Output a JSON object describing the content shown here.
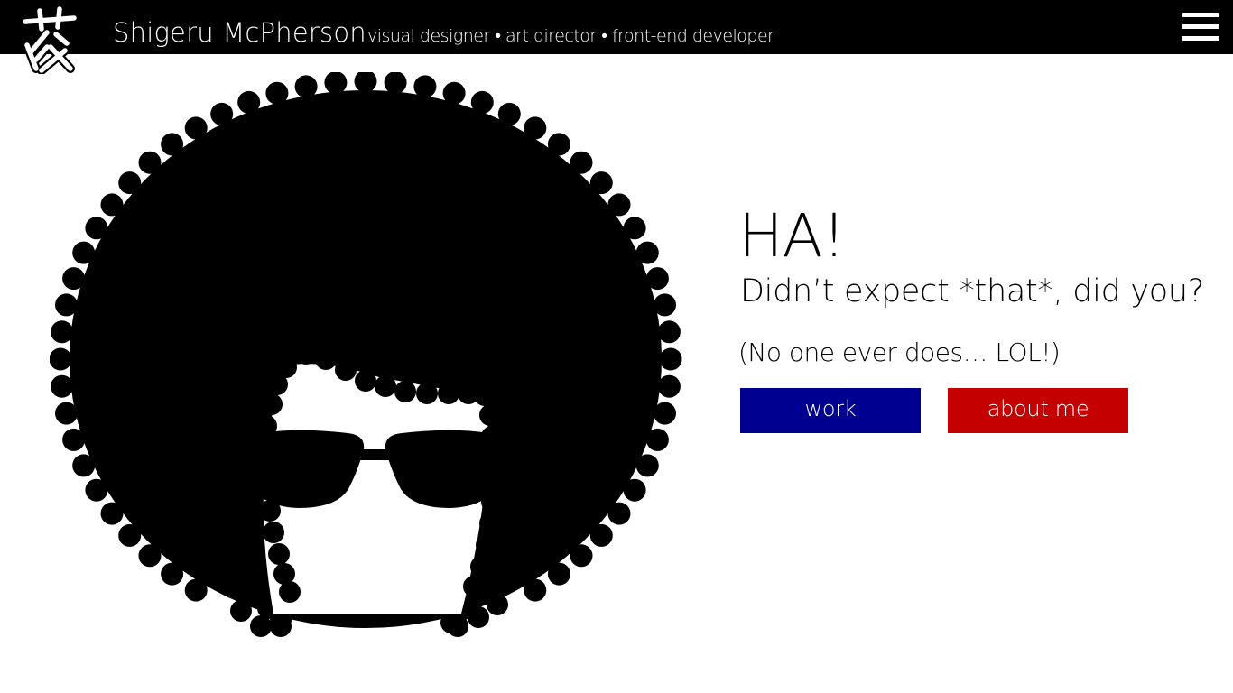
{
  "header": {
    "name": "Shigeru McPherson",
    "tagline": "visual designer • art director • front-end developer",
    "logo_icon": "kanji-logo-icon",
    "menu_icon": "hamburger-menu-icon"
  },
  "hero": {
    "headline": "HA!",
    "subhead": "Didn’t expect *that*, did you?",
    "aside": "(No one ever does… LOL!)",
    "illustration_icon": "afro-sunglasses-illustration"
  },
  "buttons": {
    "work_label": "work",
    "about_label": "about me"
  },
  "colors": {
    "topbar": "#000000",
    "work_button": "#000090",
    "about_button": "#c40000",
    "background": "#ffffff"
  }
}
